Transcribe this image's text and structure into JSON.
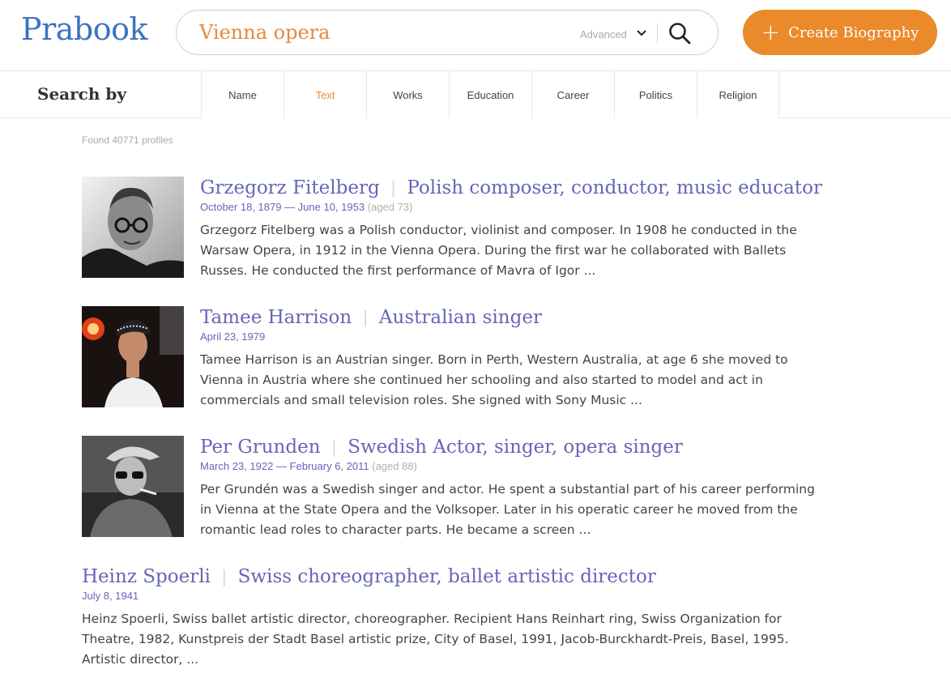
{
  "brand": {
    "logo": "Prabook",
    "primary_color": "#3a73c1",
    "accent_color": "#ea8a2a",
    "link_color": "#6466b8"
  },
  "search": {
    "query": "Vienna opera",
    "advanced_label": "Advanced",
    "advanced_icon": "chevron-down-icon",
    "search_icon": "search-icon"
  },
  "create_button": {
    "label": "Create Biography",
    "icon": "plus-icon"
  },
  "search_by": {
    "title": "Search by",
    "tabs": [
      {
        "label": "Name",
        "active": false
      },
      {
        "label": "Text",
        "active": true
      },
      {
        "label": "Works",
        "active": false
      },
      {
        "label": "Education",
        "active": false
      },
      {
        "label": "Career",
        "active": false
      },
      {
        "label": "Politics",
        "active": false
      },
      {
        "label": "Religion",
        "active": false
      }
    ]
  },
  "results_summary": "Found 40771 profiles",
  "results": [
    {
      "name": "Grzegorz Fitelberg",
      "occupation": "Polish composer, conductor, music educator",
      "dates": "October 18, 1879 — June 10, 1953",
      "aged": "(aged 73)",
      "description": "Grzegorz Fitelberg was a Polish conductor, violinist and composer. In 1908 he conducted in the Warsaw Opera, in 1912 in the Vienna Opera. During the first war he collaborated with Ballets Russes. He conducted the first performance of Mavra of Igor ..."
    },
    {
      "name": "Tamee Harrison",
      "occupation": "Australian singer",
      "dates": "April 23, 1979",
      "aged": "",
      "description": "Tamee Harrison is an Austrian singer. Born in Perth, Western Australia, at age 6 she moved to Vienna in Austria where she continued her schooling and also started to model and act in commercials and small television roles. She signed with Sony Music ..."
    },
    {
      "name": "Per Grunden",
      "occupation": "Swedish Actor, singer, opera singer",
      "dates": "March 23, 1922 — February 6, 2011",
      "aged": "(aged 88)",
      "description": "Per Grundén was a Swedish singer and actor. He spent a substantial part of his career performing in Vienna at the State Opera and the Volksoper. Later in his operatic career he moved from the romantic lead roles to character parts. He became a screen ..."
    },
    {
      "name": "Heinz Spoerli",
      "occupation": "Swiss choreographer, ballet artistic director",
      "dates": "July 8, 1941",
      "aged": "",
      "description": "Heinz Spoerli, Swiss ballet artistic director, choreographer. Recipient Hans Reinhart ring, Swiss Organization for Theatre, 1982, Kunstpreis der Stadt Basel artistic prize, City of Basel, 1991, Jacob-Burckhardt-Preis, Basel, 1995. Artistic director, ..."
    }
  ]
}
